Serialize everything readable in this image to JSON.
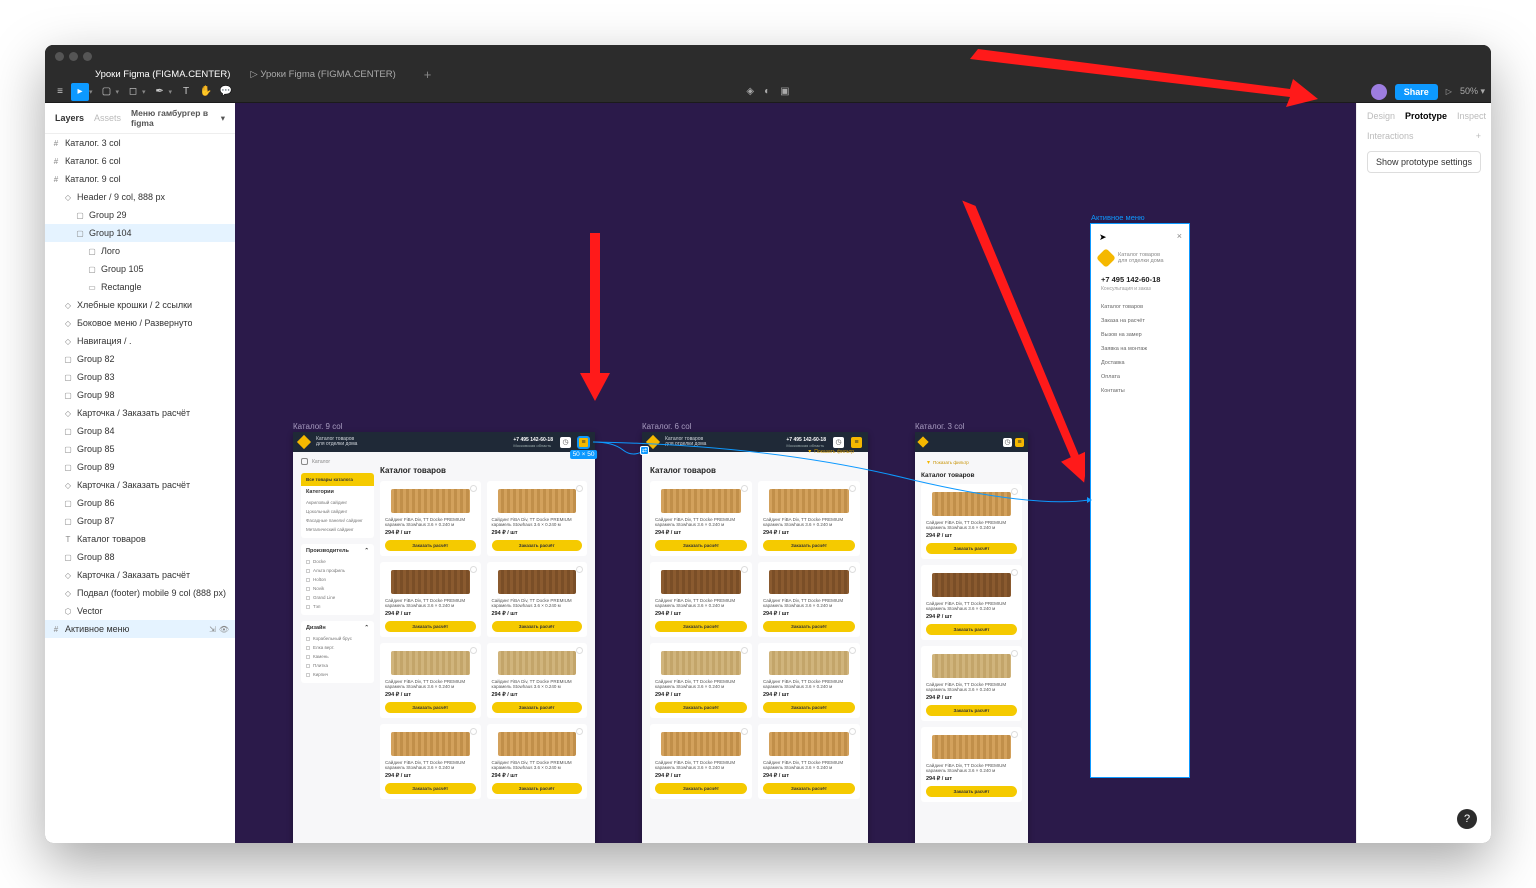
{
  "tabs": {
    "active": "Уроки Figma (FIGMA.CENTER)",
    "inactive": "▷ Уроки Figma (FIGMA.CENTER)"
  },
  "toolbar": {
    "share": "Share",
    "zoom": "50%"
  },
  "leftPanel": {
    "layersTab": "Layers",
    "assetsTab": "Assets",
    "page": "Меню гамбургер в figma",
    "layers": [
      {
        "n": "Каталог. 3 col",
        "i": 0,
        "ic": "#"
      },
      {
        "n": "Каталог. 6 col",
        "i": 0,
        "ic": "#"
      },
      {
        "n": "Каталог. 9 col",
        "i": 0,
        "ic": "#"
      },
      {
        "n": "Header / 9 col, 888 px",
        "i": 1,
        "ic": "◇"
      },
      {
        "n": "Group 29",
        "i": 2,
        "ic": "▢"
      },
      {
        "n": "Group 104",
        "i": 2,
        "ic": "▢",
        "sel": true
      },
      {
        "n": "Лого",
        "i": 3,
        "ic": "▢"
      },
      {
        "n": "Group 105",
        "i": 3,
        "ic": "▢"
      },
      {
        "n": "Rectangle",
        "i": 3,
        "ic": "▭"
      },
      {
        "n": "Хлебные крошки / 2 ссылки",
        "i": 1,
        "ic": "◇"
      },
      {
        "n": "Боковое меню / Развернуто",
        "i": 1,
        "ic": "◇"
      },
      {
        "n": "Навигация / .",
        "i": 1,
        "ic": "◇"
      },
      {
        "n": "Group 82",
        "i": 1,
        "ic": "▢"
      },
      {
        "n": "Group 83",
        "i": 1,
        "ic": "▢"
      },
      {
        "n": "Group 98",
        "i": 1,
        "ic": "▢"
      },
      {
        "n": "Карточка / Заказать расчёт",
        "i": 1,
        "ic": "◇"
      },
      {
        "n": "Group 84",
        "i": 1,
        "ic": "▢"
      },
      {
        "n": "Group 85",
        "i": 1,
        "ic": "▢"
      },
      {
        "n": "Group 89",
        "i": 1,
        "ic": "▢"
      },
      {
        "n": "Карточка / Заказать расчёт",
        "i": 1,
        "ic": "◇"
      },
      {
        "n": "Group 86",
        "i": 1,
        "ic": "▢"
      },
      {
        "n": "Group 87",
        "i": 1,
        "ic": "▢"
      },
      {
        "n": "Каталог товаров",
        "i": 1,
        "ic": "T"
      },
      {
        "n": "Group 88",
        "i": 1,
        "ic": "▢"
      },
      {
        "n": "Карточка / Заказать расчёт",
        "i": 1,
        "ic": "◇"
      },
      {
        "n": "Подвал (footer) mobile 9 col (888 px)",
        "i": 1,
        "ic": "◇"
      },
      {
        "n": "Vector",
        "i": 1,
        "ic": "⬡"
      },
      {
        "n": "Активное меню",
        "i": 0,
        "ic": "#",
        "sel2": true,
        "act": true
      }
    ]
  },
  "frames": {
    "f9": "Каталог. 9 col",
    "f6": "Каталог. 6 col",
    "f3": "Каталог. 3 col",
    "menu": "Активное меню",
    "selectedSize": "50 × 50"
  },
  "artboard": {
    "logoText": "Каталог товаров\nдля отделки дома",
    "phone": "+7 495 142-60-18",
    "phoneSub": "Московская область",
    "crumb": "Каталог",
    "title": "Каталог товаров",
    "filter": "Показать фильтр",
    "card": {
      "t": "Сайдинг FiBA Div, TT Docke PREMIUM карамель Stowhaus 3.6 × 0.240 м",
      "price": "294 ₽ / шт",
      "buy": "Заказать расчёт"
    },
    "sidebar": {
      "cat": "Категории",
      "catAll": "Все товары каталога",
      "catItems": [
        "Акриловый сайдинг",
        "Цокольный сайдинг",
        "Фасадные панели/ сайдинг",
        "Металический сайдинг"
      ],
      "man": "Производитель",
      "manItems": [
        "Docke",
        "Альта профиль",
        "Holton",
        "Novik",
        "Grand Line",
        "Тэп"
      ],
      "des": "Дизайн",
      "desItems": [
        "Корабельный брус",
        "Елка верт.",
        "Камень",
        "Плитка",
        "Кирпич"
      ]
    }
  },
  "menu": {
    "logoText": "Каталог товаров\nдля отделки дома",
    "phone": "+7 495 142-60-18",
    "sub": "Консультация и заказ",
    "items": [
      "Каталог товаров",
      "Заказа на расчёт",
      "Вызов на замер",
      "Заявка на монтаж",
      "Доставка",
      "Оплата",
      "Контакты"
    ]
  },
  "rightPanel": {
    "tabs": [
      "Design",
      "Prototype",
      "Inspect"
    ],
    "interactions": "Interactions",
    "showSettings": "Show prototype settings"
  },
  "help": "?"
}
